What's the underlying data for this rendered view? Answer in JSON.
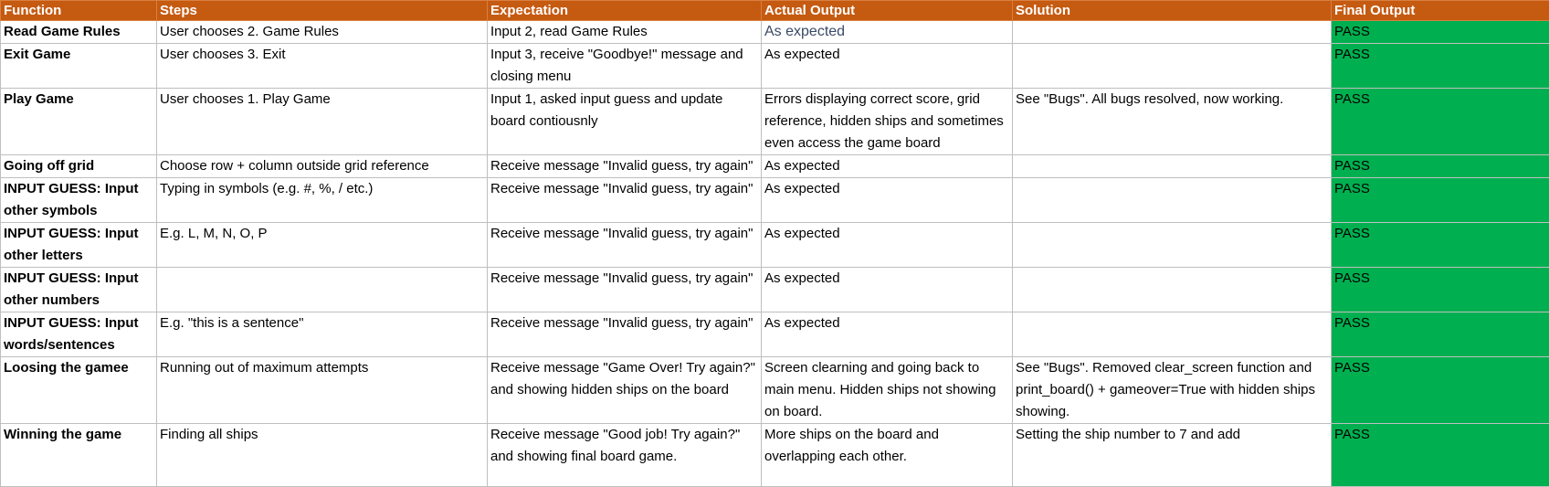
{
  "columns": [
    "Function",
    "Steps",
    "Expectation",
    "Actual Output",
    "Solution",
    "Final Output"
  ],
  "rows": [
    {
      "function": "Read Game Rules",
      "steps": "User chooses 2. Game Rules",
      "expectation": "Input 2, read Game Rules",
      "actual": "As expected",
      "solution": "",
      "final": "PASS"
    },
    {
      "function": "Exit Game",
      "steps": "User chooses 3. Exit",
      "expectation": "Input 3, receive \"Goodbye!\" message and closing menu",
      "actual": "As expected",
      "solution": "",
      "final": "PASS"
    },
    {
      "function": "Play Game",
      "steps": "User chooses 1. Play Game",
      "expectation": "Input 1, asked input guess and update board contiousnly",
      "actual": "Errors displaying correct score, grid reference, hidden ships and sometimes even access the game board",
      "solution": "See \"Bugs\". All bugs resolved, now working.",
      "final": "PASS"
    },
    {
      "function": "Going off grid",
      "steps": "Choose row + column outside grid reference",
      "expectation": "Receive message \"Invalid guess, try again\"",
      "actual": "As expected",
      "solution": "",
      "final": "PASS"
    },
    {
      "function": "INPUT GUESS: Input other symbols",
      "steps": "Typing in symbols (e.g. #, %, / etc.)",
      "expectation": "Receive message \"Invalid guess, try again\"",
      "actual": "As expected",
      "solution": "",
      "final": "PASS"
    },
    {
      "function": "INPUT GUESS: Input other letters",
      "steps": "E.g. L, M, N, O, P",
      "expectation": "Receive message \"Invalid guess, try again\"",
      "actual": "As expected",
      "solution": "",
      "final": "PASS"
    },
    {
      "function": "INPUT GUESS: Input other numbers",
      "steps": "",
      "expectation": "Receive message \"Invalid guess, try again\"",
      "actual": "As expected",
      "solution": "",
      "final": "PASS"
    },
    {
      "function": "INPUT GUESS: Input words/sentences",
      "steps": "E.g. \"this is a sentence\"",
      "expectation": "Receive message \"Invalid guess, try again\"",
      "actual": "As expected",
      "solution": "",
      "final": "PASS"
    },
    {
      "function": "Loosing the gamee",
      "steps": "Running out of maximum attempts",
      "expectation": "Receive message \"Game Over! Try again?\" and showing hidden ships on the board",
      "actual": "Screen clearning and going back to main menu. Hidden ships not showing on board.",
      "solution": "See \"Bugs\". Removed clear_screen function and print_board() + gameover=True with hidden ships showing.",
      "final": "PASS"
    },
    {
      "function": "Winning the game",
      "steps": "Finding all ships",
      "expectation": "Receive message \"Good job! Try again?\" and showing final board game.",
      "actual": "More ships on the board and overlapping each other.",
      "solution": "Setting the ship number to 7 and add",
      "final": "PASS"
    }
  ],
  "colors": {
    "header_bg": "#c55a11",
    "pass_bg": "#00b050",
    "grid_line": "#bfbfbf"
  }
}
